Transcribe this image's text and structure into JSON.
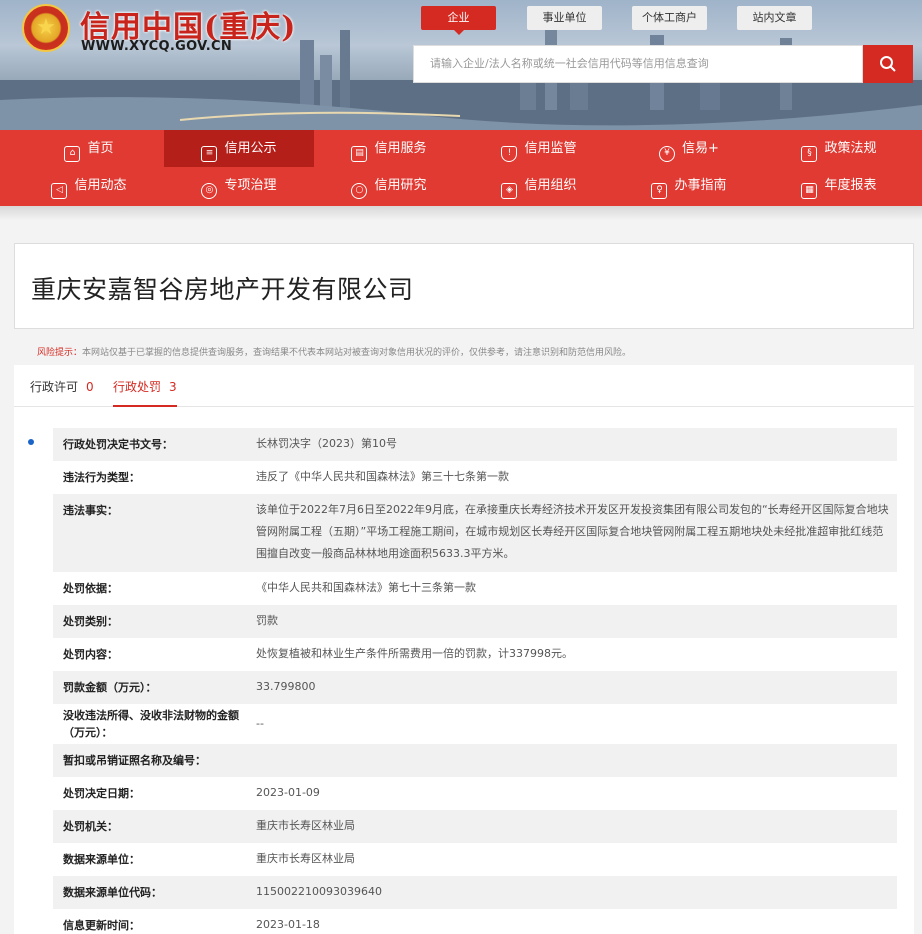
{
  "header": {
    "emblem_icon": "national-emblem-icon",
    "site_title": "信用中国(重庆)",
    "site_url": "WWW.XYCQ.GOV.CN",
    "top_tabs": [
      "企业",
      "事业单位",
      "个体工商户",
      "站内文章"
    ],
    "active_top_tab": "企业",
    "search_placeholder": "请输入企业/法人名称或统一社会信用代码等信用信息查询",
    "search_icon": "search-icon"
  },
  "nav": {
    "row1": [
      {
        "label": "首页",
        "icon": "home-icon"
      },
      {
        "label": "信用公示",
        "icon": "bulletin-icon"
      },
      {
        "label": "信用服务",
        "icon": "document-icon"
      },
      {
        "label": "信用监管",
        "icon": "shield-icon"
      },
      {
        "label": "信易+",
        "icon": "badge-icon"
      },
      {
        "label": "政策法规",
        "icon": "clipboard-icon"
      }
    ],
    "row2": [
      {
        "label": "信用动态",
        "icon": "speaker-icon"
      },
      {
        "label": "专项治理",
        "icon": "target-icon"
      },
      {
        "label": "信用研究",
        "icon": "magnifier-icon"
      },
      {
        "label": "信用组织",
        "icon": "layers-icon"
      },
      {
        "label": "办事指南",
        "icon": "guide-icon"
      },
      {
        "label": "年度报表",
        "icon": "report-icon"
      }
    ],
    "active": "信用公示"
  },
  "company": {
    "name": "重庆安嘉智谷房地产开发有限公司"
  },
  "risk": {
    "label": "风险提示：",
    "text": "本网站仅基于已掌握的信息提供查询服务，查询结果不代表本网站对被查询对象信用状况的评价，仅供参考，请注意识别和防范信用风险。"
  },
  "tabs": [
    {
      "label": "行政许可",
      "count": "0"
    },
    {
      "label": "行政处罚",
      "count": "3"
    }
  ],
  "active_tab": "行政处罚",
  "record": [
    {
      "key": "行政处罚决定书文号：",
      "value": "长林罚决字（2023）第10号"
    },
    {
      "key": "违法行为类型：",
      "value": "违反了《中华人民共和国森林法》第三十七条第一款"
    },
    {
      "key": "违法事实：",
      "value": "该单位于2022年7月6日至2022年9月底，在承接重庆长寿经济技术开发区开发投资集团有限公司发包的“长寿经开区国际复合地块管网附属工程（五期）”平场工程施工期间，在城市规划区长寿经开区国际复合地块管网附属工程五期地块处未经批准超审批红线范围擅自改变一般商品林林地用途面积5633.3平方米。"
    },
    {
      "key": "处罚依据：",
      "value": "《中华人民共和国森林法》第七十三条第一款"
    },
    {
      "key": "处罚类别：",
      "value": "罚款"
    },
    {
      "key": "处罚内容：",
      "value": "处恢复植被和林业生产条件所需费用一倍的罚款，计337998元。"
    },
    {
      "key": "罚款金额（万元）：",
      "value": "33.799800"
    },
    {
      "key": "没收违法所得、没收非法财物的金额（万元）：",
      "value": "--"
    },
    {
      "key": "暂扣或吊销证照名称及编号：",
      "value": ""
    },
    {
      "key": "处罚决定日期：",
      "value": "2023-01-09"
    },
    {
      "key": "处罚机关：",
      "value": "重庆市长寿区林业局"
    },
    {
      "key": "数据来源单位：",
      "value": "重庆市长寿区林业局"
    },
    {
      "key": "数据来源单位代码：",
      "value": "115002210093039640"
    },
    {
      "key": "信息更新时间：",
      "value": "2023-01-18"
    }
  ]
}
